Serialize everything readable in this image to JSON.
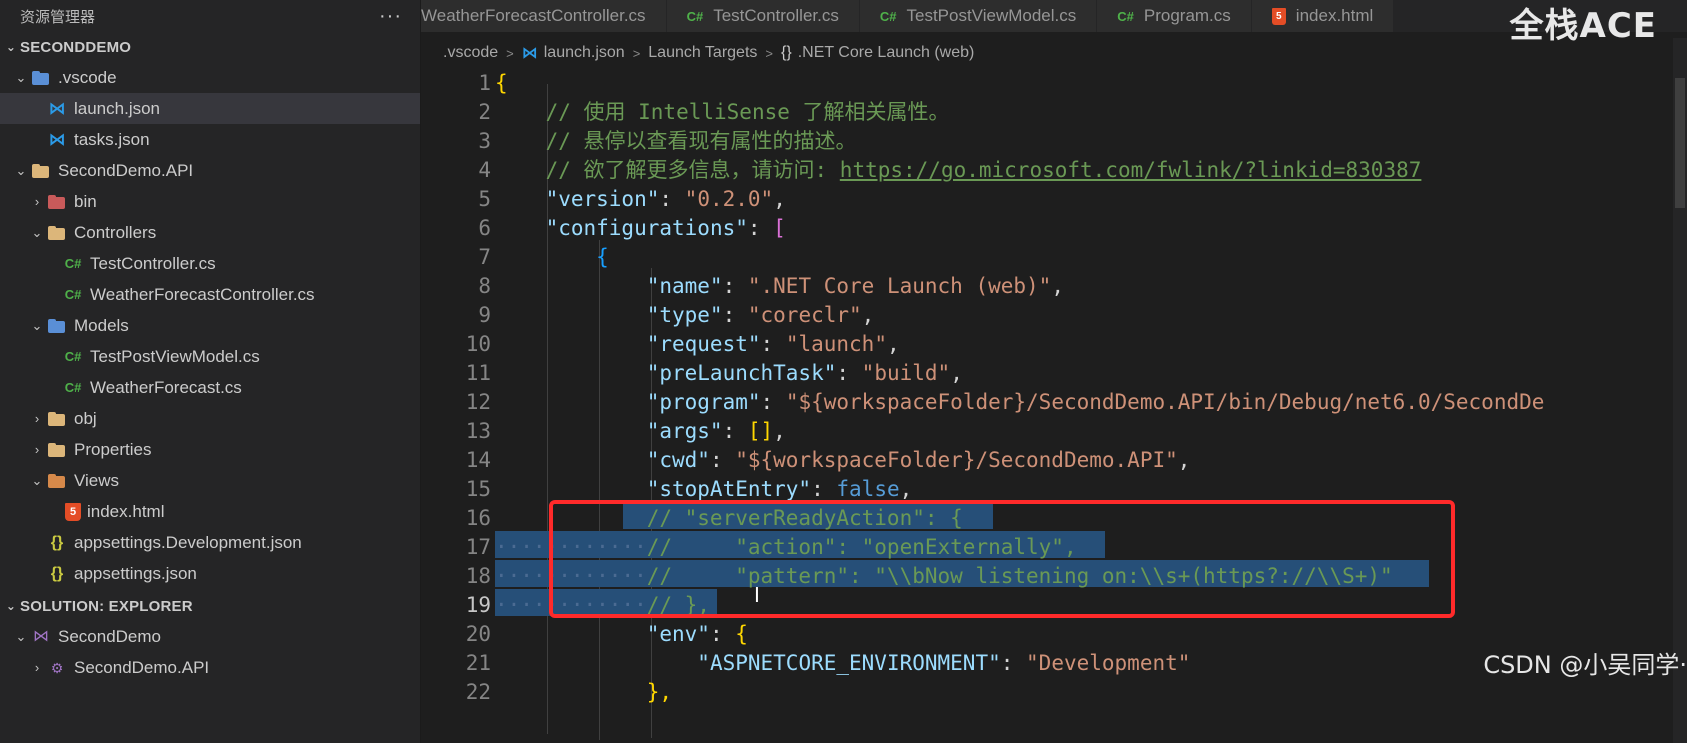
{
  "sidebar": {
    "header_title": "资源管理器",
    "more_label": "···",
    "workspace_title": "SECONDDEMO",
    "tree": [
      {
        "label": ".vscode",
        "level": 0,
        "chevron": "v",
        "icon": "folder-vscode-icon"
      },
      {
        "label": "launch.json",
        "level": 1,
        "chevron": "",
        "icon": "vscode-file-icon",
        "selected": true
      },
      {
        "label": "tasks.json",
        "level": 1,
        "chevron": "",
        "icon": "vscode-file-icon"
      },
      {
        "label": "SecondDemo.API",
        "level": 0,
        "chevron": "v",
        "icon": "folder-icon"
      },
      {
        "label": "bin",
        "level": 1,
        "chevron": ">",
        "icon": "folder-bin-icon"
      },
      {
        "label": "Controllers",
        "level": 1,
        "chevron": "v",
        "icon": "folder-controllers-icon"
      },
      {
        "label": "TestController.cs",
        "level": 2,
        "chevron": "",
        "icon": "csharp-icon"
      },
      {
        "label": "WeatherForecastController.cs",
        "level": 2,
        "chevron": "",
        "icon": "csharp-icon"
      },
      {
        "label": "Models",
        "level": 1,
        "chevron": "v",
        "icon": "folder-models-icon"
      },
      {
        "label": "TestPostViewModel.cs",
        "level": 2,
        "chevron": "",
        "icon": "csharp-icon"
      },
      {
        "label": "WeatherForecast.cs",
        "level": 2,
        "chevron": "",
        "icon": "csharp-icon"
      },
      {
        "label": "obj",
        "level": 1,
        "chevron": ">",
        "icon": "folder-icon"
      },
      {
        "label": "Properties",
        "level": 1,
        "chevron": ">",
        "icon": "folder-icon"
      },
      {
        "label": "Views",
        "level": 1,
        "chevron": "v",
        "icon": "folder-views-icon"
      },
      {
        "label": "index.html",
        "level": 2,
        "chevron": "",
        "icon": "html-icon"
      },
      {
        "label": "appsettings.Development.json",
        "level": 1,
        "chevron": "",
        "icon": "json-icon"
      },
      {
        "label": "appsettings.json",
        "level": 1,
        "chevron": "",
        "icon": "json-icon"
      }
    ],
    "solution_title": "SOLUTION: EXPLORER",
    "solution_tree": [
      {
        "label": "SecondDemo",
        "level": 0,
        "chevron": "v",
        "icon": "solution-icon"
      },
      {
        "label": "SecondDemo.API",
        "level": 1,
        "chevron": ">",
        "icon": "project-icon"
      }
    ]
  },
  "tabs": [
    {
      "label": "WeatherForecastController.cs",
      "icon": ""
    },
    {
      "label": "TestController.cs",
      "icon": "C#"
    },
    {
      "label": "TestPostViewModel.cs",
      "icon": "C#"
    },
    {
      "label": "Program.cs",
      "icon": "C#"
    },
    {
      "label": "index.html",
      "icon": "html"
    }
  ],
  "watermark": "全栈ACE",
  "breadcrumb": {
    "folder": ".vscode",
    "file": "launch.json",
    "section": "Launch Targets",
    "symbol": ".NET Core Launch (web)",
    "symbol_icon": "{}"
  },
  "editor": {
    "active_line": 19,
    "lines": [
      {
        "n": "1"
      },
      {
        "n": "2"
      },
      {
        "n": "3"
      },
      {
        "n": "4"
      },
      {
        "n": "5"
      },
      {
        "n": "6"
      },
      {
        "n": "7"
      },
      {
        "n": "8"
      },
      {
        "n": "9"
      },
      {
        "n": "10"
      },
      {
        "n": "11"
      },
      {
        "n": "12"
      },
      {
        "n": "13"
      },
      {
        "n": "14"
      },
      {
        "n": "15"
      },
      {
        "n": "16"
      },
      {
        "n": "17"
      },
      {
        "n": "18"
      },
      {
        "n": "19"
      },
      {
        "n": "20"
      },
      {
        "n": "21"
      },
      {
        "n": "22"
      }
    ],
    "text": {
      "l2_comment": "// 使用 IntelliSense 了解相关属性。",
      "l3_comment": "// 悬停以查看现有属性的描述。",
      "l4_comment": "// 欲了解更多信息，请访问: ",
      "l4_url": "https://go.microsoft.com/fwlink/?linkid=830387",
      "version_key": "\"version\"",
      "version_val": "\"0.2.0\"",
      "configurations_key": "\"configurations\"",
      "name_key": "\"name\"",
      "name_val": "\".NET Core Launch (web)\"",
      "type_key": "\"type\"",
      "type_val": "\"coreclr\"",
      "request_key": "\"request\"",
      "request_val": "\"launch\"",
      "prelaunch_key": "\"preLaunchTask\"",
      "prelaunch_val": "\"build\"",
      "program_key": "\"program\"",
      "program_val": "\"${workspaceFolder}/SecondDemo.API/bin/Debug/net6.0/SecondDe",
      "args_key": "\"args\"",
      "args_val": "[]",
      "cwd_key": "\"cwd\"",
      "cwd_val": "\"${workspaceFolder}/SecondDemo.API\"",
      "stop_key": "\"stopAtEntry\"",
      "stop_val": "false",
      "l16_comment": "// \"serverReadyAction\": {",
      "l17_comment": "//     \"action\": \"openExternally\",",
      "l18_comment": "//     \"pattern\": \"\\\\bNow listening on:\\\\s+(https?://\\\\S+)\"",
      "l19_comment": "// },",
      "env_key": "\"env\"",
      "aspnet_key": "\"ASPNETCORE_ENVIRONMENT\"",
      "aspnet_val": "\"Development\"",
      "l22_close": "},"
    }
  },
  "overlay_caption": "CSDN @小吴同学·",
  "colors": {
    "highlight_box": "#ff2a2a",
    "selection": "#264f78",
    "comment": "#6a9955",
    "string": "#ce9178",
    "key": "#9cdcfe"
  }
}
